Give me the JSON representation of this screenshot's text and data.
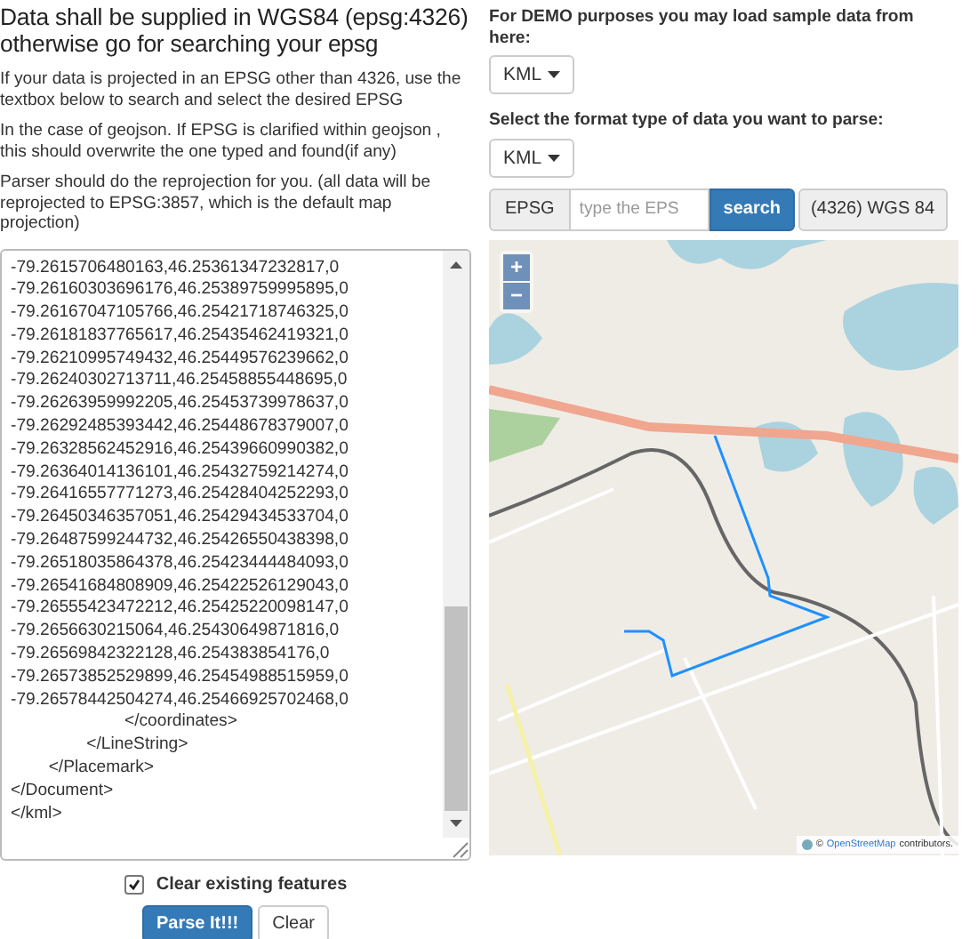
{
  "intro": {
    "heading": "Data shall be supplied in WGS84 (epsg:4326) otherwise go for searching your epsg",
    "notes": [
      "If your data is projected in an EPSG other than 4326, use the textbox below to search and select the desired EPSG",
      "In the case of geojson. If EPSG is clarified within geojson , this should overwrite the one typed and found(if any)",
      "Parser should do the reprojection for you. (all data will be reprojected to EPSG:3857, which is the default map projection)"
    ]
  },
  "data_field": {
    "lines": [
      "-79.2615706480163,46.25361347232817,0",
      "-79.26160303696176,46.25389759995895,0",
      "-79.26167047105766,46.25421718746325,0",
      "-79.26181837765617,46.25435462419321,0",
      "-79.26210995749432,46.25449576239662,0",
      "-79.26240302713711,46.25458855448695,0",
      "-79.26263959992205,46.25453739978637,0",
      "-79.26292485393442,46.25448678379007,0",
      "-79.26328562452916,46.25439660990382,0",
      "-79.26364014136101,46.25432759214274,0",
      "-79.26416557771273,46.25428404252293,0",
      "-79.26450346357051,46.25429434533704,0",
      "-79.26487599244732,46.25426550438398,0",
      "-79.26518035864378,46.25423444484093,0",
      "-79.26541684808909,46.25422526129043,0",
      "-79.26555423472212,46.25425220098147,0",
      "-79.2656630215064,46.25430649871816,0",
      "-79.26569842322128,46.254383854176,0",
      "-79.26573852529899,46.25454988515959,0",
      "-79.26578442504274,46.25466925702468,0",
      "                        </coordinates>",
      "                </LineString>",
      "        </Placemark>",
      "</Document>",
      "</kml>"
    ]
  },
  "clear_features": {
    "label": "Clear existing features",
    "checked": true
  },
  "buttons": [
    {
      "label": "Parse It!!!",
      "kind": "primary"
    },
    {
      "label": "Clear",
      "kind": "default"
    }
  ],
  "demo": {
    "label": "For DEMO purposes you may load sample data from here:",
    "dropdown": "KML"
  },
  "format": {
    "label": "Select the format type of data you want to parse:",
    "dropdown": "KML"
  },
  "epsg": {
    "prefix": "EPSG",
    "placeholder": "type the EPS",
    "button": "search",
    "result": "(4326) WGS 84"
  },
  "map": {
    "zoom_in": "+",
    "zoom_out": "−",
    "attribution_prefix": "©",
    "attribution_link": "OpenStreetMap",
    "attribution_suffix": "contributors."
  }
}
